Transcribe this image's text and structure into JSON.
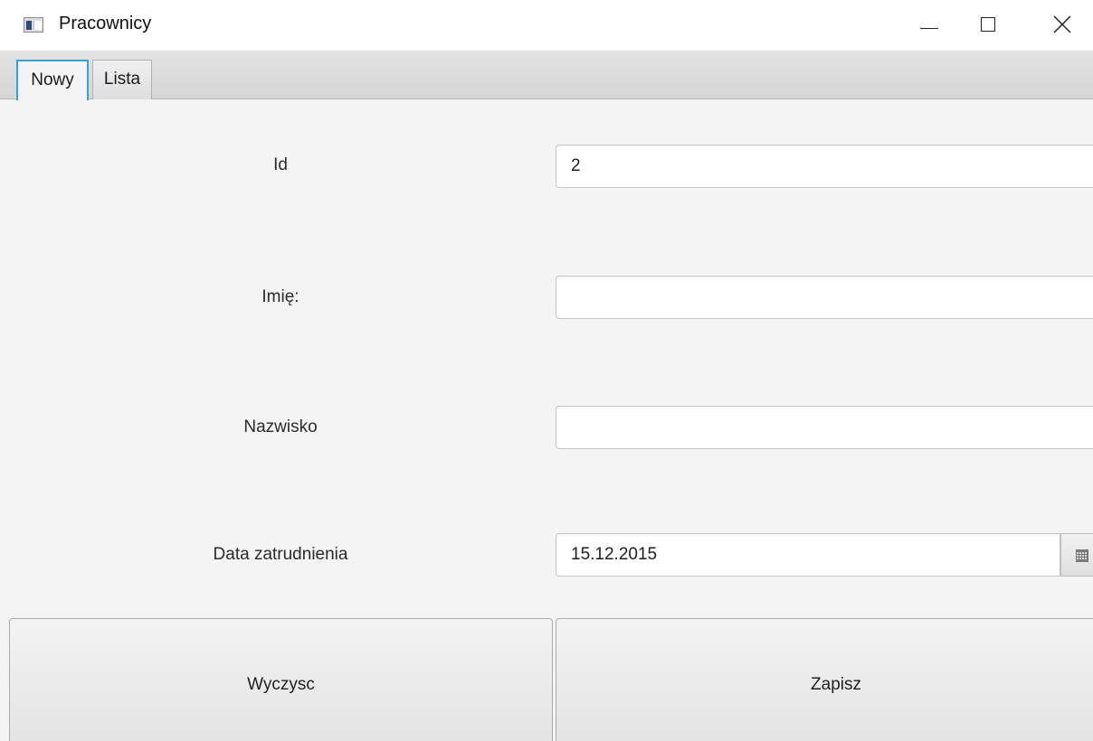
{
  "window": {
    "title": "Pracownicy",
    "controls": [
      "minimize",
      "maximize",
      "close"
    ]
  },
  "tabs": [
    {
      "label": "Nowy",
      "active": true
    },
    {
      "label": "Lista",
      "active": false
    }
  ],
  "form": {
    "id": {
      "label": "Id",
      "value": "2"
    },
    "first_name": {
      "label": "Imię:",
      "value": ""
    },
    "last_name": {
      "label": "Nazwisko",
      "value": ""
    },
    "hire_date": {
      "label": "Data zatrudnienia",
      "value": "15.12.2015"
    }
  },
  "buttons": {
    "clear_label": "Wyczysc",
    "save_label": "Zapisz"
  },
  "colors": {
    "tab_focus": "#37a1d6",
    "background": "#f4f4f4"
  }
}
